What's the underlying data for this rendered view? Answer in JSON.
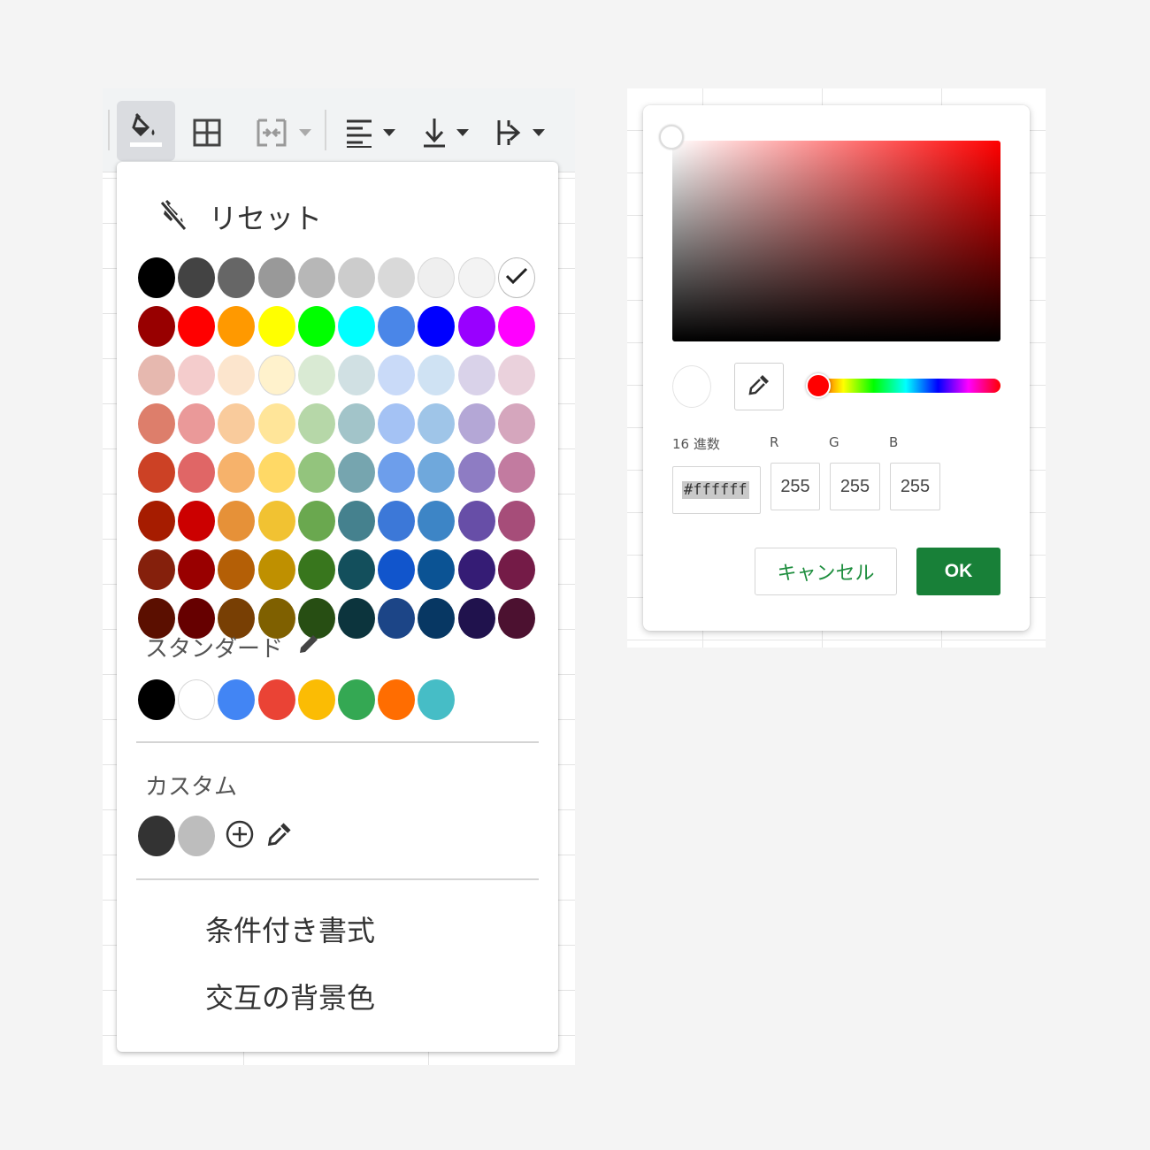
{
  "toolbar": {
    "items": [
      "fill-color-icon",
      "borders-icon",
      "merge-cells-icon",
      "horizontal-align-icon",
      "vertical-align-icon",
      "text-wrap-icon"
    ]
  },
  "palette": {
    "reset_label": "リセット",
    "grid_colors": [
      [
        "#000000",
        "#434343",
        "#666666",
        "#999999",
        "#b7b7b7",
        "#cccccc",
        "#d9d9d9",
        "#efefef",
        "#f3f3f3",
        "#ffffff"
      ],
      [
        "#980000",
        "#ff0000",
        "#ff9900",
        "#ffff00",
        "#00ff00",
        "#00ffff",
        "#4a86e8",
        "#0000ff",
        "#9900ff",
        "#ff00ff"
      ],
      [
        "#e6b8af",
        "#f4cccc",
        "#fce5cd",
        "#fff2cc",
        "#d9ead3",
        "#d0e0e3",
        "#c9daf8",
        "#cfe2f3",
        "#d9d2e9",
        "#ead1dc"
      ],
      [
        "#dd7e6b",
        "#ea9999",
        "#f9cb9c",
        "#ffe599",
        "#b6d7a8",
        "#a2c4c9",
        "#a4c2f4",
        "#9fc5e8",
        "#b4a7d6",
        "#d5a6bd"
      ],
      [
        "#cc4125",
        "#e06666",
        "#f6b26b",
        "#ffd966",
        "#93c47d",
        "#76a5af",
        "#6d9eeb",
        "#6fa8dc",
        "#8e7cc3",
        "#c27ba0"
      ],
      [
        "#a61c00",
        "#cc0000",
        "#e69138",
        "#f1c232",
        "#6aa84f",
        "#45818e",
        "#3c78d8",
        "#3d85c6",
        "#674ea7",
        "#a64d79"
      ],
      [
        "#85200c",
        "#990000",
        "#b45f06",
        "#bf9000",
        "#38761d",
        "#134f5c",
        "#1155cc",
        "#0b5394",
        "#351c75",
        "#741b47"
      ],
      [
        "#5b0f00",
        "#660000",
        "#783f04",
        "#7f6000",
        "#274e13",
        "#0c343d",
        "#1c4587",
        "#073763",
        "#20124d",
        "#4c1130"
      ]
    ],
    "selected_color": "#ffffff",
    "standard_label": "スタンダード",
    "standard_colors": [
      "#000000",
      "#ffffff",
      "#4285f4",
      "#ea4335",
      "#fbbc04",
      "#34a853",
      "#ff6d01",
      "#46bdc6"
    ],
    "custom_label": "カスタム",
    "custom_colors": [
      "#333333",
      "#bdbdbd"
    ],
    "menu": {
      "conditional_format": "条件付き書式",
      "alternating_colors": "交互の背景色"
    }
  },
  "dialog": {
    "hex_label": "16 進数",
    "r_label": "R",
    "g_label": "G",
    "b_label": "B",
    "hex_value": "#ffffff",
    "r_value": "255",
    "g_value": "255",
    "b_value": "255",
    "cancel_label": "キャンセル",
    "ok_label": "OK",
    "current_color": "#ffffff",
    "hue_color": "#ff0000"
  }
}
